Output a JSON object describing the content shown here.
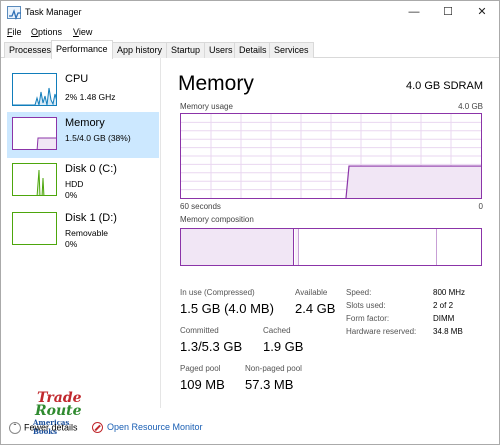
{
  "window": {
    "title": "Task Manager"
  },
  "menu": [
    {
      "label": "File",
      "accel": "F",
      "rest": "ile"
    },
    {
      "label": "Options",
      "accel": "O",
      "rest": "ptions"
    },
    {
      "label": "View",
      "accel": "V",
      "rest": "iew"
    }
  ],
  "tabs": [
    "Processes",
    "Performance",
    "App history",
    "Startup",
    "Users",
    "Details",
    "Services"
  ],
  "active_tab": "Performance",
  "sidebar": [
    {
      "title": "CPU",
      "line1": "2% 1.48 GHz",
      "line2": "",
      "color": "#117dbb"
    },
    {
      "title": "Memory",
      "line1": "1.5/4.0 GB (38%)",
      "line2": "",
      "color": "#8b34a8"
    },
    {
      "title": "Disk 0 (C:)",
      "line1": "HDD",
      "line2": "0%",
      "color": "#4da60c"
    },
    {
      "title": "Disk 1 (D:)",
      "line1": "Removable",
      "line2": "0%",
      "color": "#4da60c"
    }
  ],
  "main": {
    "title": "Memory",
    "type": "4.0 GB SDRAM",
    "usage_label": "Memory usage",
    "usage_max": "4.0 GB",
    "time_left": "60 seconds",
    "time_right": "0",
    "composition_label": "Memory composition",
    "usage_fraction": 0.38
  },
  "stats": {
    "in_use_label": "In use (Compressed)",
    "in_use_value": "1.5 GB (4.0 MB)",
    "available_label": "Available",
    "available_value": "2.4 GB",
    "committed_label": "Committed",
    "committed_value": "1.3/5.3 GB",
    "cached_label": "Cached",
    "cached_value": "1.9 GB",
    "paged_label": "Paged pool",
    "paged_value": "109 MB",
    "nonpaged_label": "Non-paged pool",
    "nonpaged_value": "57.3 MB"
  },
  "specs": [
    {
      "label": "Speed:",
      "value": "800 MHz"
    },
    {
      "label": "Slots used:",
      "value": "2 of 2"
    },
    {
      "label": "Form factor:",
      "value": "DIMM"
    },
    {
      "label": "Hardware reserved:",
      "value": "34.8 MB"
    }
  ],
  "footer": {
    "fewer_details": "Fewer details",
    "open_monitor": "Open Resource Monitor",
    "logo_line1": "Trade",
    "logo_line2": "Route",
    "logo_line3": "Americas Books"
  },
  "colors": {
    "accent": "#8b34a8",
    "cpu": "#117dbb",
    "disk": "#4da60c",
    "selected": "#cce8ff",
    "link": "#1a5fb4"
  }
}
